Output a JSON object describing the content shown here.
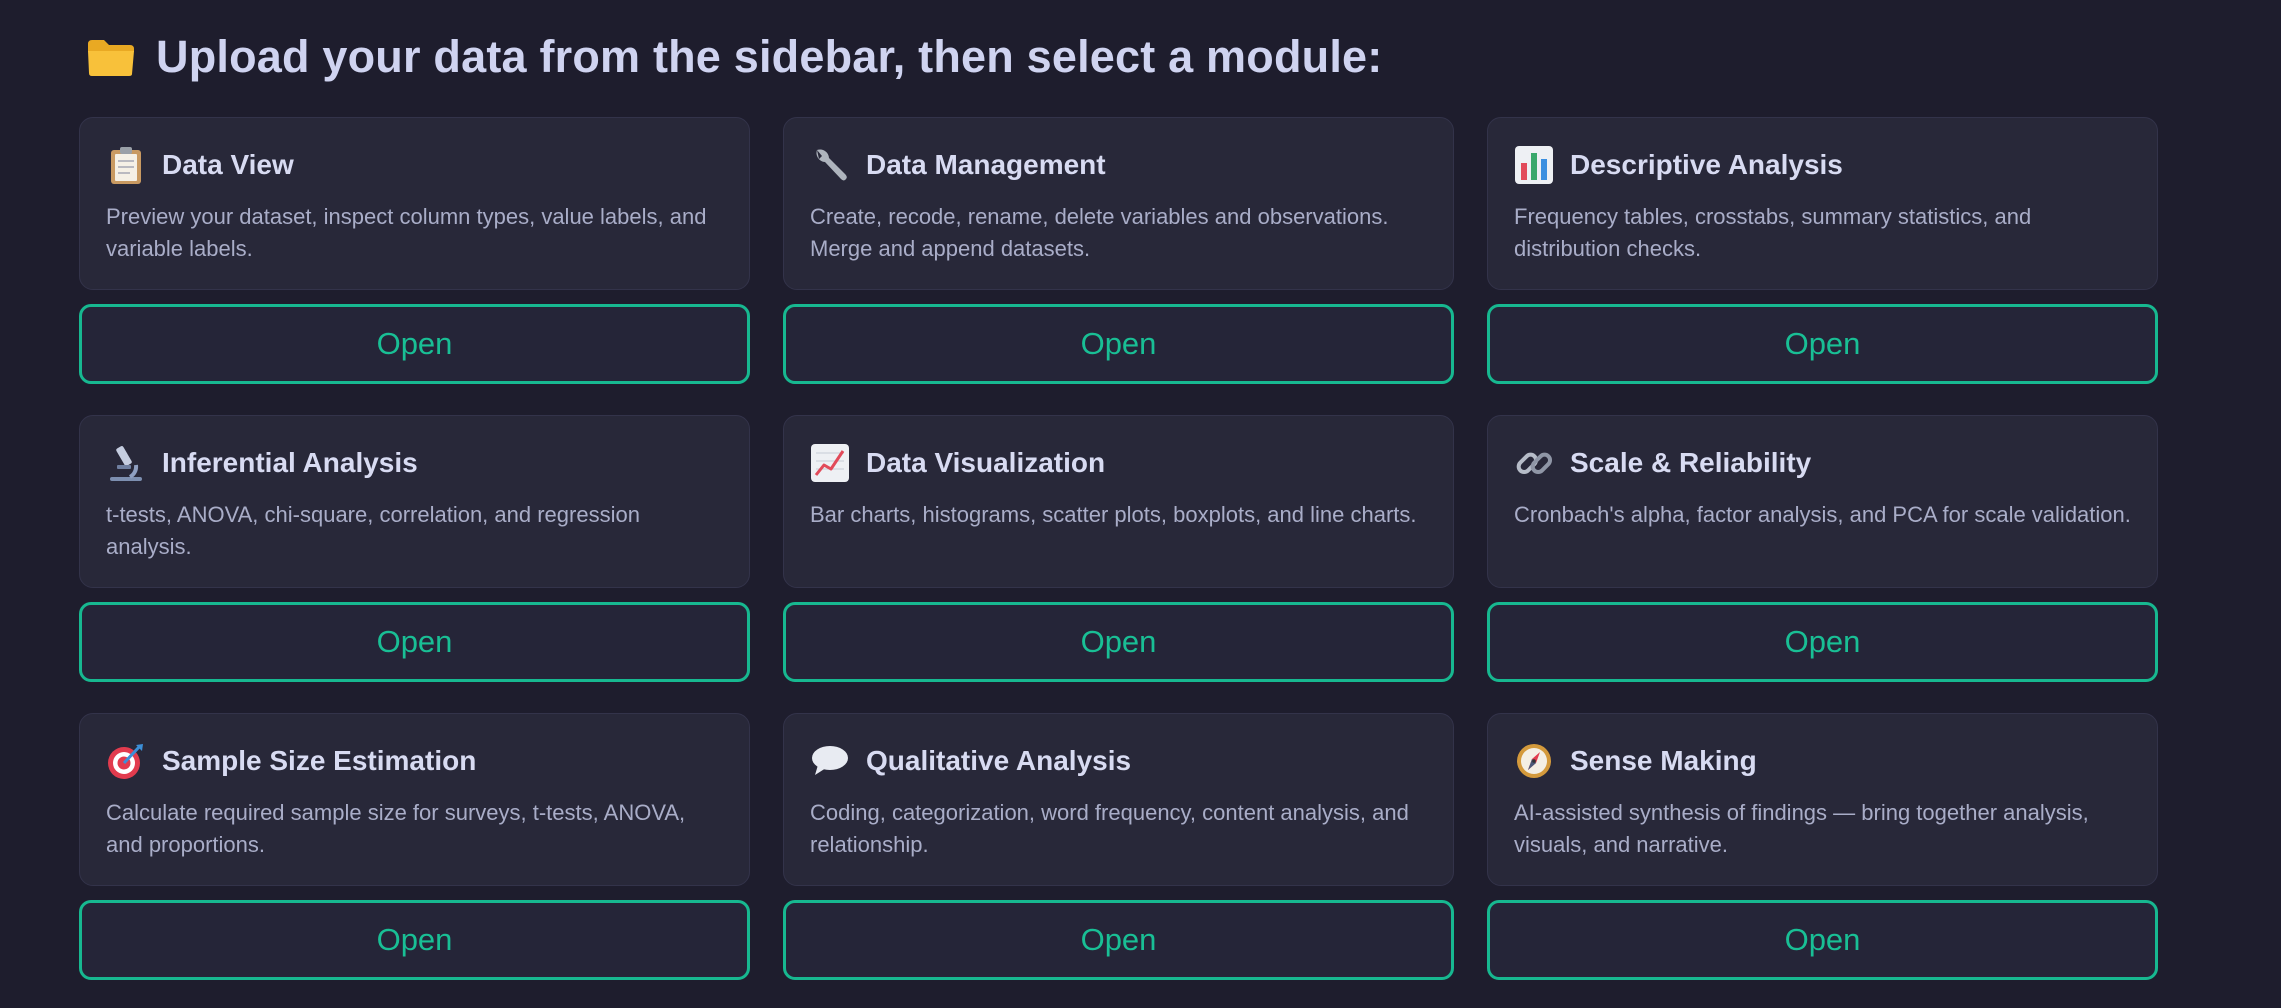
{
  "header": {
    "title": "Upload your data from the sidebar, then select a module:",
    "icon": "folder-icon"
  },
  "colors": {
    "background": "#1e1d2d",
    "card": "#282839",
    "accent": "#17b890",
    "title_text": "#d8dbf2",
    "desc_text": "#a9adc8"
  },
  "modules": [
    {
      "title": "Data View",
      "icon": "clipboard-icon",
      "description": "Preview your dataset, inspect column types, value labels, and variable labels.",
      "button_label": "Open"
    },
    {
      "title": "Data Management",
      "icon": "wrench-icon",
      "description": "Create, recode, rename, delete variables and observations. Merge and append datasets.",
      "button_label": "Open"
    },
    {
      "title": "Descriptive Analysis",
      "icon": "bar-chart-icon",
      "description": "Frequency tables, crosstabs, summary statistics, and distribution checks.",
      "button_label": "Open"
    },
    {
      "title": "Inferential Analysis",
      "icon": "microscope-icon",
      "description": "t-tests, ANOVA, chi-square, correlation, and regression analysis.",
      "button_label": "Open"
    },
    {
      "title": "Data Visualization",
      "icon": "line-chart-icon",
      "description": "Bar charts, histograms, scatter plots, boxplots, and line charts.",
      "button_label": "Open"
    },
    {
      "title": "Scale & Reliability",
      "icon": "link-icon",
      "description": "Cronbach's alpha, factor analysis, and PCA for scale validation.",
      "button_label": "Open"
    },
    {
      "title": "Sample Size Estimation",
      "icon": "target-icon",
      "description": "Calculate required sample size for surveys, t-tests, ANOVA, and proportions.",
      "button_label": "Open"
    },
    {
      "title": "Qualitative Analysis",
      "icon": "speech-bubble-icon",
      "description": "Coding, categorization, word frequency, content analysis, and relationship.",
      "button_label": "Open"
    },
    {
      "title": "Sense Making",
      "icon": "compass-icon",
      "description": "AI-assisted synthesis of findings — bring together analysis, visuals, and narrative.",
      "button_label": "Open"
    }
  ]
}
